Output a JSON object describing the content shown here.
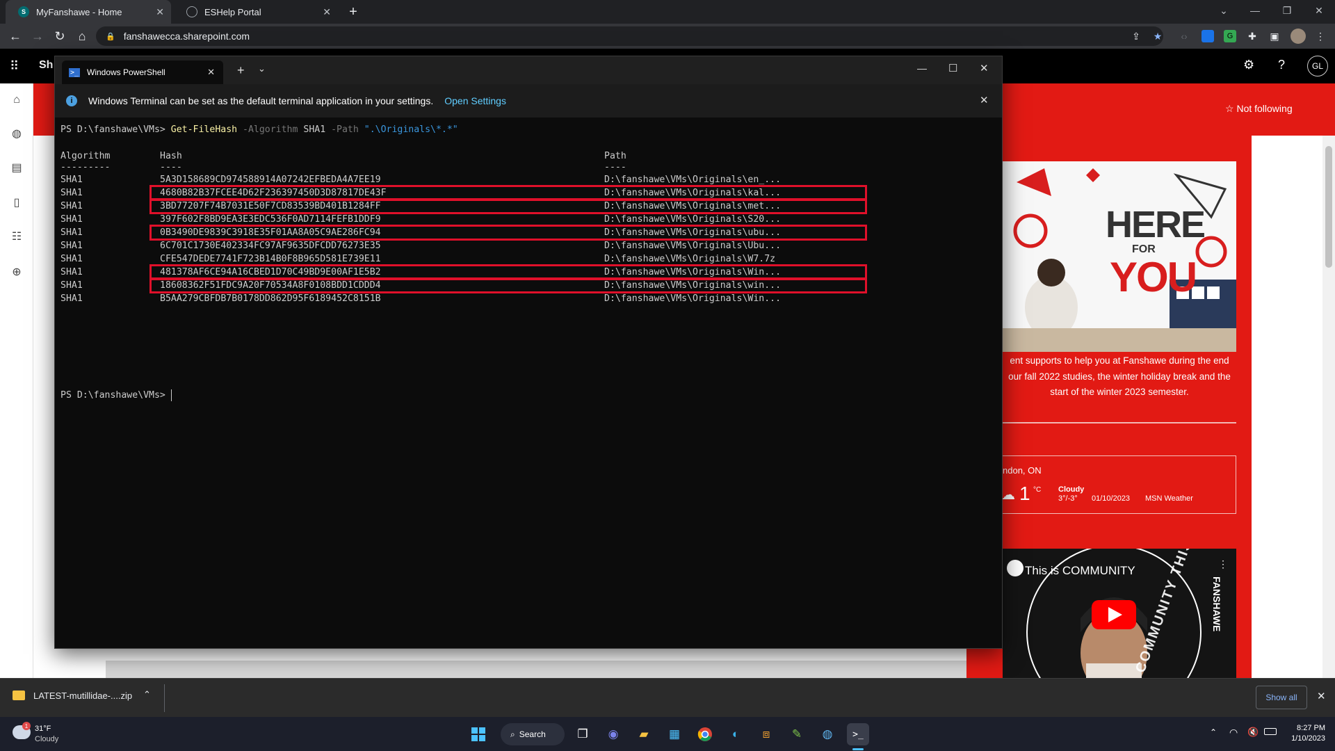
{
  "browser": {
    "tabs": [
      {
        "title": "MyFanshawe - Home",
        "active": true
      },
      {
        "title": "ESHelp Portal",
        "active": false
      }
    ],
    "url": "fanshawecca.sharepoint.com"
  },
  "sharepoint": {
    "brand_partial": "Sh",
    "avatar_initials": "GL",
    "follow_label": "Not following",
    "promo_text_lines": [
      "ent supports to help you at Fanshawe during the end",
      "our fall 2022 studies, the winter holiday break and the",
      "start of the winter 2023 semester."
    ],
    "poster": {
      "line1": "HERE",
      "line2": "FOR",
      "line3": "YOU"
    },
    "weather": {
      "location": "ndon, ON",
      "temp": "1",
      "unit": "°C",
      "condition": "Cloudy",
      "range": "3°/-3°",
      "date": "01/10/2023",
      "source": "MSN Weather"
    },
    "video": {
      "title": "This is COMMUNITY",
      "brand": "FANSHAWE",
      "ring_text": "THIS IS COMMUNITY THIS IS"
    }
  },
  "terminal": {
    "tab_title": "Windows PowerShell",
    "info_message": "Windows Terminal can be set as the default terminal application in your settings.",
    "info_link": "Open Settings",
    "prompt": "PS D:\\fanshawe\\VMs> ",
    "command": "Get-FileHash",
    "param1": "-Algorithm",
    "arg1": "SHA1",
    "param2": "-Path",
    "arg2": "\".\\Originals\\*.*\"",
    "headers": {
      "algorithm": "Algorithm",
      "hash": "Hash",
      "path": "Path"
    },
    "separators": {
      "algorithm": "---------",
      "hash": "----",
      "path": "----"
    },
    "rows": [
      {
        "alg": "SHA1",
        "hash": "5A3D158689CD974588914A07242EFBEDA4A7EE19",
        "path": "D:\\fanshawe\\VMs\\Originals\\en_...",
        "highlighted": false
      },
      {
        "alg": "SHA1",
        "hash": "4680B82B37FCEE4D62F236397450D3D87817DE43F",
        "path": "D:\\fanshawe\\VMs\\Originals\\kal...",
        "highlighted": true
      },
      {
        "alg": "SHA1",
        "hash": "3BD77207F74B7031E50F7CD83539BD401B1284FF",
        "path": "D:\\fanshawe\\VMs\\Originals\\met...",
        "highlighted": true
      },
      {
        "alg": "SHA1",
        "hash": "397F602F8BD9EA3E3EDC536F0AD7114FEFB1DDF9",
        "path": "D:\\fanshawe\\VMs\\Originals\\S20...",
        "highlighted": false
      },
      {
        "alg": "SHA1",
        "hash": "0B3490DE9839C3918E35F01AA8A05C9AE286FC94",
        "path": "D:\\fanshawe\\VMs\\Originals\\ubu...",
        "highlighted": true
      },
      {
        "alg": "SHA1",
        "hash": "6C701C1730E402334FC97AF9635DFCDD76273E35",
        "path": "D:\\fanshawe\\VMs\\Originals\\Ubu...",
        "highlighted": false
      },
      {
        "alg": "SHA1",
        "hash": "CFE547DEDE7741F723B14B0F8B965D581E739E11",
        "path": "D:\\fanshawe\\VMs\\Originals\\W7.7z",
        "highlighted": false
      },
      {
        "alg": "SHA1",
        "hash": "481378AF6CE94A16CBED1D70C49BD9E00AF1E5B2",
        "path": "D:\\fanshawe\\VMs\\Originals\\Win...",
        "highlighted": true
      },
      {
        "alg": "SHA1",
        "hash": "18608362F51FDC9A20F70534A8F0108BDD1CDDD4",
        "path": "D:\\fanshawe\\VMs\\Originals\\win...",
        "highlighted": true
      },
      {
        "alg": "SHA1",
        "hash": "B5AA279CBFDB7B0178DD862D95F6189452C8151B",
        "path": "D:\\fanshawe\\VMs\\Originals\\Win...",
        "highlighted": false
      }
    ]
  },
  "downloads": {
    "file": "LATEST-mutillidae-....zip",
    "show_all": "Show all"
  },
  "taskbar": {
    "weather_temp": "31°F",
    "weather_cond": "Cloudy",
    "weather_badge": "1",
    "search_label": "Search",
    "time": "8:27 PM",
    "date": "1/10/2023"
  },
  "colors": {
    "fanshawe_red": "#e21a14",
    "highlight_box": "#e0102a",
    "ps_command": "#f9f1a5",
    "ps_param": "#767676",
    "ps_string": "#3a96dd",
    "info_link": "#60cdff"
  }
}
